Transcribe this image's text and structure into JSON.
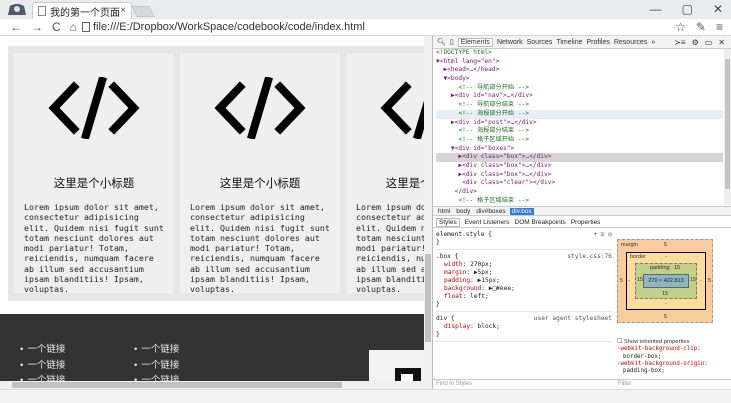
{
  "browser": {
    "tab_title": "我的第一个页面",
    "tab_close": "×",
    "window_controls": [
      "—",
      "▢",
      "✕"
    ],
    "url": "file:///E:/Dropbox/WorkSpace/codebook/code/index.html"
  },
  "page": {
    "boxes": [
      {
        "subtitle": "这里是个小标题",
        "body": "Lorem ipsum dolor sit amet, consectetur adipisicing elit. Quidem nisi fugit sunt totam nesciunt dolores aut modi pariatur! Totam, reiciendis, numquam facere ab illum sed accusantium ipsam blanditiis! Ipsam, voluptas."
      },
      {
        "subtitle": "这里是个小标题",
        "body": "Lorem ipsum dolor sit amet, consectetur adipisicing elit. Quidem nisi fugit sunt totam nesciunt dolores aut modi pariatur! Totam, reiciendis, numquam facere ab illum sed accusantium ipsam blanditiis! Ipsam, voluptas."
      },
      {
        "subtitle": "这里是个小标题",
        "body": "Lorem ipsum dolor sit amet, consectetur adipisicing elit. Quidem nisi fugit sunt totam nesciunt dolores aut modi pariatur! Totam, reiciendis, numquam facere ab illum sed accusantium ipsam blanditiis! Ipsam, voluptas."
      }
    ],
    "footer_links_left": [
      "一个链接",
      "一个链接",
      "一个链接"
    ],
    "footer_links_right": [
      "一个链接",
      "一个链接",
      "一个链接"
    ]
  },
  "devtools": {
    "tabs": [
      "Elements",
      "Network",
      "Sources",
      "Timeline",
      "Profiles",
      "Resources",
      "»"
    ],
    "active_tab": "Elements",
    "dom_lines": [
      {
        "text": "<!DOCTYPE html>",
        "cls": "cmt",
        "row": ""
      },
      {
        "text": "▼<html lang=\"en\">",
        "cls": "tag",
        "row": ""
      },
      {
        "text": "  ▶<head>…</head>",
        "cls": "tag",
        "row": ""
      },
      {
        "text": "  ▼<body>",
        "cls": "tag",
        "row": ""
      },
      {
        "text": "      <!-- 导航部分开始 -->",
        "cls": "cmt",
        "row": ""
      },
      {
        "text": "    ▶<div id=\"nav\">…</div>",
        "cls": "tag",
        "row": ""
      },
      {
        "text": "      <!-- 导航部分结束 -->",
        "cls": "cmt",
        "row": ""
      },
      {
        "text": "      <!-- 海报部分开始 -->",
        "cls": "cmt",
        "row": "hl"
      },
      {
        "text": "    ▶<div id=\"post\">…</div>",
        "cls": "tag",
        "row": ""
      },
      {
        "text": "      <!-- 海报部分结束 -->",
        "cls": "cmt",
        "row": ""
      },
      {
        "text": "      <!-- 格子区域开始 -->",
        "cls": "cmt",
        "row": ""
      },
      {
        "text": "    ▼<div id=\"boxes\">",
        "cls": "tag",
        "row": ""
      },
      {
        "text": "      ▶<div class=\"box\">…</div>",
        "cls": "tag",
        "row": "sel"
      },
      {
        "text": "      ▶<div class=\"box\">…</div>",
        "cls": "tag",
        "row": ""
      },
      {
        "text": "      ▶<div class=\"box\">…</div>",
        "cls": "tag",
        "row": ""
      },
      {
        "text": "       <div class=\"clear\"></div>",
        "cls": "tag",
        "row": ""
      },
      {
        "text": "     </div>",
        "cls": "tag",
        "row": ""
      },
      {
        "text": "      <!-- 格子区域结束 -->",
        "cls": "cmt",
        "row": ""
      },
      {
        "text": "      <!-- 页尾开始 -->",
        "cls": "cmt",
        "row": ""
      },
      {
        "text": "    ▶<div id=\"footer\">…</div>",
        "cls": "tag",
        "row": ""
      }
    ],
    "breadcrumbs": [
      "html",
      "body",
      "div#boxes",
      "div.box"
    ],
    "active_crumb": "div.box",
    "subtabs": [
      "Styles",
      "Event Listeners",
      "DOM Breakpoints",
      "Properties"
    ],
    "active_subtab": "Styles",
    "styles": {
      "element_style": "element.style {",
      "element_close": "}",
      "tool_icons": "+ ⊡ ◎",
      "box_selector": ".box {",
      "box_source": "style.css:76",
      "box_props": [
        {
          "name": "width",
          "value": "270px;"
        },
        {
          "name": "margin",
          "value": "▶5px;"
        },
        {
          "name": "padding",
          "value": "▶15px;"
        },
        {
          "name": "background",
          "value": "▶□#eee;"
        },
        {
          "name": "float",
          "value": "left;"
        }
      ],
      "box_close": "}",
      "div_selector": "div {",
      "div_source": "user agent stylesheet",
      "div_props": [
        {
          "name": "display",
          "value": "block;"
        }
      ],
      "div_close": "}"
    },
    "box_model": {
      "margin_label": "margin",
      "margin": "5",
      "border_label": "border",
      "border": "-",
      "padding_label": "padding",
      "padding": "15",
      "content": "270 × 422.813",
      "side_margin": "5",
      "side_padding": "15",
      "side_border": "-"
    },
    "inherited": {
      "label": "Show inherited properties",
      "props": [
        "-webkit-background-clip:",
        "border-box;",
        "-webkit-background-origin:",
        "padding-box;"
      ]
    },
    "find_placeholder": "Find in Styles",
    "filter_placeholder": "Filter"
  }
}
